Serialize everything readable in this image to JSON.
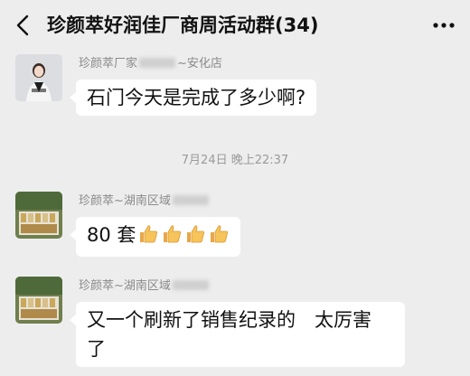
{
  "header": {
    "title": "珍颜萃好润佳厂商周活动群(34)",
    "back_icon": "chevron-left-icon",
    "more_icon": "more-dots-icon"
  },
  "messages": [
    {
      "sender": "珍颜萃厂家",
      "sender_suffix": "~安化店",
      "text": "石门今天是完成了多少啊?"
    },
    {
      "sender": "珍颜萃~湖南区域",
      "sender_suffix": "",
      "text": "80 套",
      "emoji": [
        "thumbs-up",
        "thumbs-up",
        "thumbs-up",
        "thumbs-up"
      ]
    },
    {
      "sender": "珍颜萃~湖南区域",
      "sender_suffix": "",
      "text_line1": "又一个刷新了销售纪录的　太厉害",
      "text_line2": "了"
    }
  ],
  "timestamp": "7月24日 晚上22:37",
  "colors": {
    "background": "#ededed",
    "bubble": "#ffffff",
    "meta_text": "#8a8a8a"
  }
}
